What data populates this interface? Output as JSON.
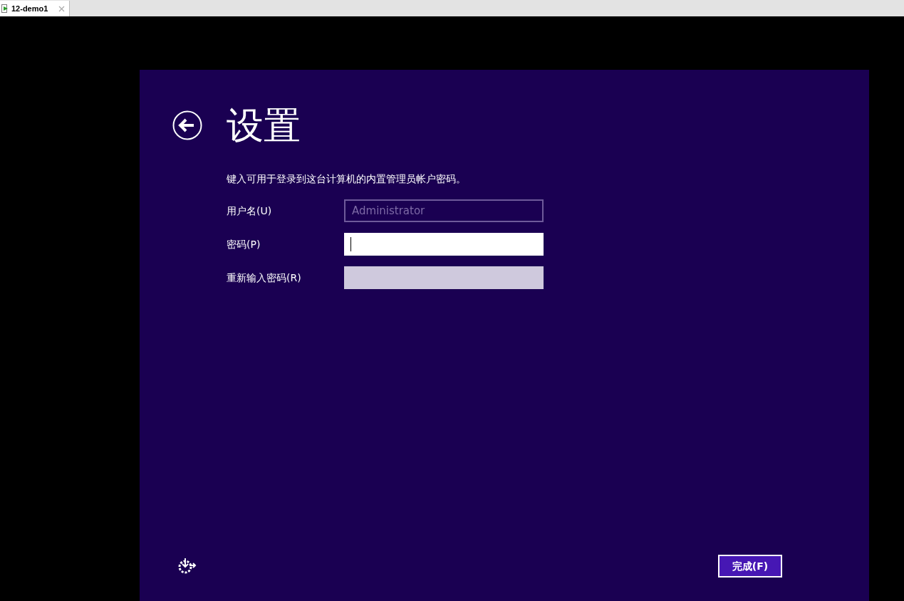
{
  "tab": {
    "title": "12-demo1"
  },
  "page": {
    "title": "设置",
    "description": "键入可用于登录到这台计算机的内置管理员帐户密码。"
  },
  "fields": [
    {
      "label": "用户名(U)",
      "value": "Administrator",
      "kind": "readonly",
      "focused": false
    },
    {
      "label": "密码(P)",
      "kind": "active",
      "focused": true
    },
    {
      "label": "重新输入密码(R)",
      "kind": "inactive",
      "focused": false
    }
  ],
  "finish_button": {
    "label": "完成(F)"
  }
}
